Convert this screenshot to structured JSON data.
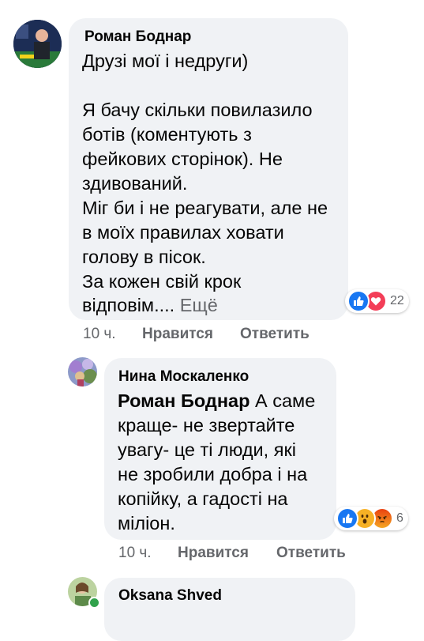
{
  "comments": [
    {
      "author": "Роман Боднар",
      "text_lines": [
        "Друзі мої і недруги)",
        "",
        "Я бачу скільки повилазило",
        "ботів (коментують з",
        "фейкових сторінок). Не",
        "здивований.",
        "Міг би і не реагувати, але не",
        "в моїх правилах ховати",
        "голову в пісок.",
        "За кожен свій крок",
        "відповім...."
      ],
      "see_more": "Ещё",
      "reaction_count": "22",
      "time": "10 ч.",
      "like_label": "Нравится",
      "reply_label": "Ответить"
    },
    {
      "author": "Нина Москаленко",
      "mention": "Роман Боднар",
      "text_first": " А саме",
      "text_lines": [
        "краще- не звертайте",
        "увагу- це ті люди, які",
        "не зробили добра і на",
        "копійку, а гадості на",
        "міліон."
      ],
      "reaction_count": "6",
      "time": "10 ч.",
      "like_label": "Нравится",
      "reply_label": "Ответить"
    },
    {
      "author": "Oksana Shved"
    }
  ],
  "colors": {
    "bubble": "#f0f2f5",
    "like": "#1877f2",
    "love": "#f33e58",
    "haha": "#f7b125",
    "angry": "#e9710f",
    "muted": "#65676b"
  },
  "icons": [
    "avatar",
    "like-reaction-icon",
    "love-reaction-icon",
    "wow-reaction-icon",
    "angry-reaction-icon"
  ]
}
